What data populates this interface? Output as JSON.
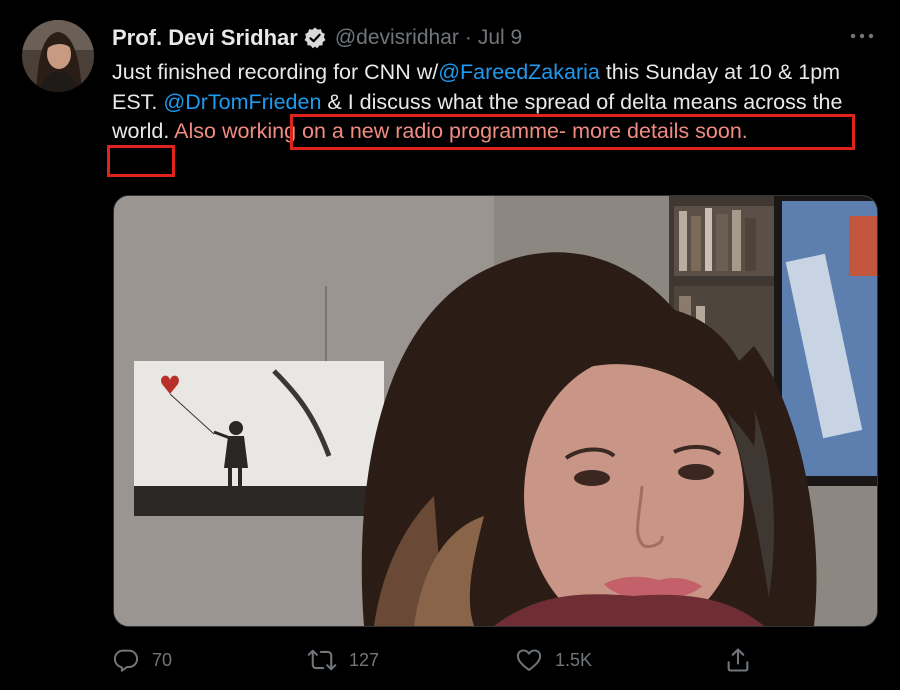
{
  "author": {
    "display_name": "Prof. Devi Sridhar",
    "handle": "@devisridhar",
    "separator": "·",
    "date": "Jul 9",
    "verified": true
  },
  "tweet": {
    "text_part1": "Just finished recording for CNN w/",
    "mention1": "@FareedZakaria",
    "text_part2": " this Sunday at 10 & 1pm EST. ",
    "mention2": "@DrTomFrieden",
    "text_part3": " & I discuss what the spread of delta means across the world. ",
    "highlighted": "Also working on a new radio programme- more details soon."
  },
  "actions": {
    "reply_count": "70",
    "retweet_count": "127",
    "like_count": "1.5K"
  },
  "icons": {
    "verified": "verified-badge-icon",
    "more": "more-options-icon",
    "reply": "reply-icon",
    "retweet": "retweet-icon",
    "like": "heart-icon",
    "share": "share-icon"
  },
  "colors": {
    "background": "#000000",
    "text": "#e7e9ea",
    "muted": "#71767b",
    "mention": "#1d9bf0",
    "highlight_box": "#e0241b",
    "highlight_text": "#f28b82"
  }
}
